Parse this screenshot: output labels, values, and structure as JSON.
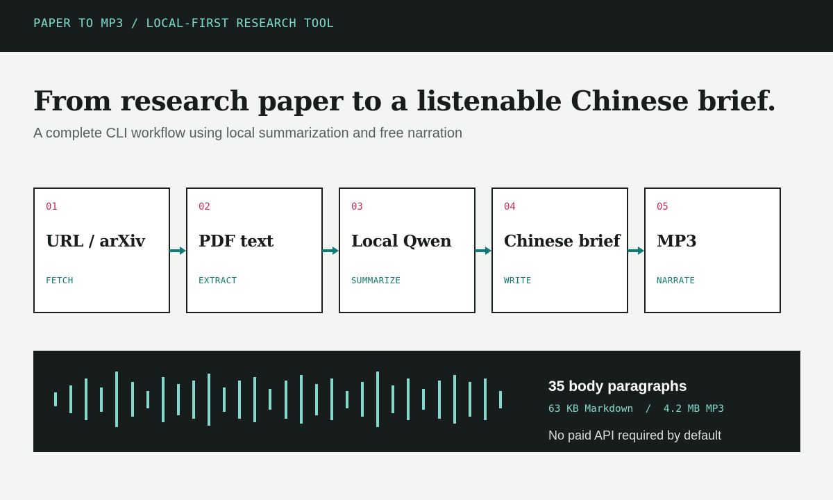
{
  "header": {
    "breadcrumb": "PAPER TO MP3 / LOCAL-FIRST RESEARCH TOOL"
  },
  "hero": {
    "title": "From research paper to a listenable Chinese brief.",
    "subtitle": "A complete CLI workflow using local summarization and free narration"
  },
  "pipeline": {
    "steps": [
      {
        "number": "01",
        "title": "URL / arXiv",
        "action": "FETCH"
      },
      {
        "number": "02",
        "title": "PDF text",
        "action": "EXTRACT"
      },
      {
        "number": "03",
        "title": "Local Qwen",
        "action": "SUMMARIZE"
      },
      {
        "number": "04",
        "title": "Chinese brief",
        "action": "WRITE"
      },
      {
        "number": "05",
        "title": "MP3",
        "action": "NARRATE"
      }
    ]
  },
  "audio": {
    "headline": "35 body paragraphs",
    "sizes": "63 KB Markdown  /  4.2 MB MP3",
    "note": "No paid API required by default",
    "waveform_levels": [
      0.2,
      0.4,
      0.6,
      0.35,
      0.8,
      0.5,
      0.25,
      0.65,
      0.45,
      0.55,
      0.75,
      0.35,
      0.55,
      0.65,
      0.3,
      0.55,
      0.7,
      0.45,
      0.6,
      0.25,
      0.5,
      0.8,
      0.4,
      0.6,
      0.3,
      0.55,
      0.7,
      0.5,
      0.6,
      0.25
    ]
  },
  "colors": {
    "dark": "#171d1c",
    "accent_teal": "#0f7a72",
    "accent_mint": "#84d9cc",
    "accent_red": "#c2305a",
    "background": "#f3f5f2"
  }
}
